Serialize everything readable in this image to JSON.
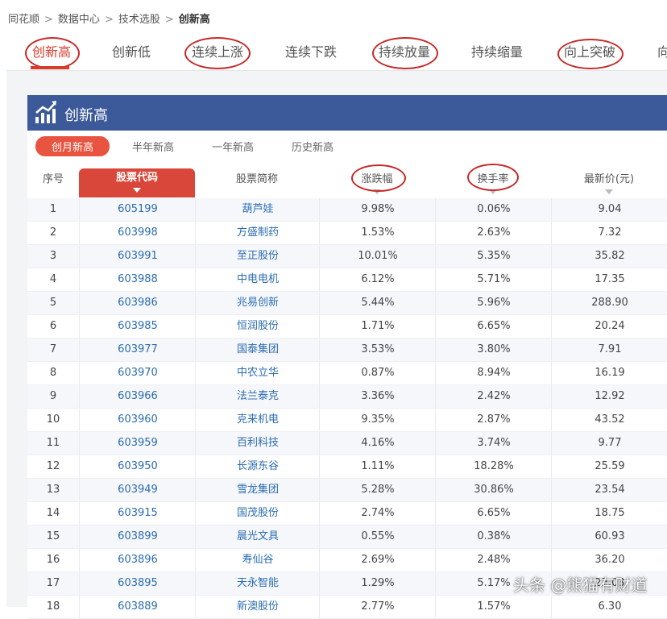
{
  "breadcrumb": {
    "items": [
      "同花顺",
      "数据中心",
      "技术选股"
    ],
    "current": "创新高",
    "separator": ">"
  },
  "tabs": [
    "创新高",
    "创新低",
    "连续上涨",
    "连续下跌",
    "持续放量",
    "持续缩量",
    "向上突破",
    "向"
  ],
  "active_tab": "创新高",
  "panel": {
    "title": "创新高"
  },
  "subtabs": [
    "创月新高",
    "半年新高",
    "一年新高",
    "历史新高"
  ],
  "columns": {
    "seq": "序号",
    "code": "股票代码",
    "name": "股票简称",
    "change": "涨跌幅",
    "turnover": "换手率",
    "price": "最新价(元)"
  },
  "rows": [
    {
      "seq": "1",
      "code": "605199",
      "name": "葫芦娃",
      "change": "9.98%",
      "turnover": "0.06%",
      "price": "9.04"
    },
    {
      "seq": "2",
      "code": "603998",
      "name": "方盛制药",
      "change": "1.53%",
      "turnover": "2.63%",
      "price": "7.32"
    },
    {
      "seq": "3",
      "code": "603991",
      "name": "至正股份",
      "change": "10.01%",
      "turnover": "5.35%",
      "price": "35.82"
    },
    {
      "seq": "4",
      "code": "603988",
      "name": "中电电机",
      "change": "6.12%",
      "turnover": "5.71%",
      "price": "17.35"
    },
    {
      "seq": "5",
      "code": "603986",
      "name": "兆易创新",
      "change": "5.44%",
      "turnover": "5.96%",
      "price": "288.90"
    },
    {
      "seq": "6",
      "code": "603985",
      "name": "恒润股份",
      "change": "1.71%",
      "turnover": "6.65%",
      "price": "20.24"
    },
    {
      "seq": "7",
      "code": "603977",
      "name": "国泰集团",
      "change": "3.53%",
      "turnover": "3.80%",
      "price": "7.91"
    },
    {
      "seq": "8",
      "code": "603970",
      "name": "中农立华",
      "change": "0.87%",
      "turnover": "8.94%",
      "price": "16.19"
    },
    {
      "seq": "9",
      "code": "603966",
      "name": "法兰泰克",
      "change": "3.36%",
      "turnover": "2.42%",
      "price": "12.92"
    },
    {
      "seq": "10",
      "code": "603960",
      "name": "克来机电",
      "change": "9.35%",
      "turnover": "2.87%",
      "price": "43.52"
    },
    {
      "seq": "11",
      "code": "603959",
      "name": "百利科技",
      "change": "4.16%",
      "turnover": "3.74%",
      "price": "9.77"
    },
    {
      "seq": "12",
      "code": "603950",
      "name": "长源东谷",
      "change": "1.11%",
      "turnover": "18.28%",
      "price": "25.59"
    },
    {
      "seq": "13",
      "code": "603949",
      "name": "雪龙集团",
      "change": "5.28%",
      "turnover": "30.86%",
      "price": "23.54"
    },
    {
      "seq": "14",
      "code": "603915",
      "name": "国茂股份",
      "change": "2.74%",
      "turnover": "6.65%",
      "price": "18.75"
    },
    {
      "seq": "15",
      "code": "603899",
      "name": "晨光文具",
      "change": "0.55%",
      "turnover": "0.38%",
      "price": "60.93"
    },
    {
      "seq": "16",
      "code": "603896",
      "name": "寿仙谷",
      "change": "2.69%",
      "turnover": "2.48%",
      "price": "36.20"
    },
    {
      "seq": "17",
      "code": "603895",
      "name": "天永智能",
      "change": "1.29%",
      "turnover": "5.17%",
      "price": "22.03"
    },
    {
      "seq": "18",
      "code": "603889",
      "name": "新澳股份",
      "change": "2.77%",
      "turnover": "1.57%",
      "price": "6.30"
    }
  ],
  "watermark": "头条 @熊猫有财道"
}
